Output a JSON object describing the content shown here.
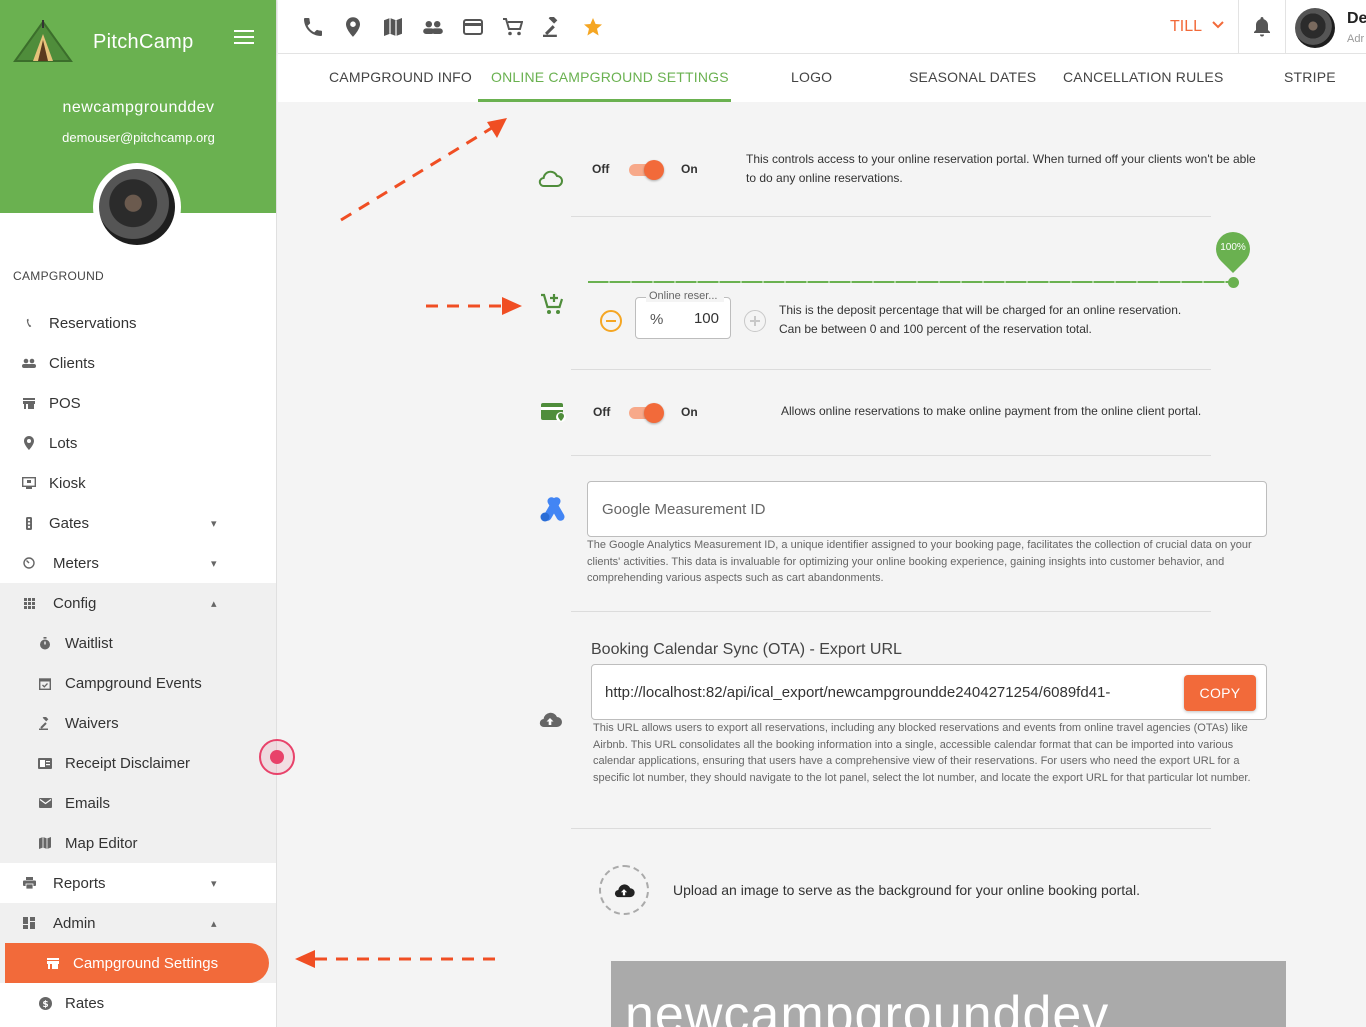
{
  "brand": {
    "name": "PitchCamp"
  },
  "user": {
    "name": "newcampgrounddev",
    "email": "demouser@pitchcamp.org"
  },
  "sidebar": {
    "section_label": "CAMPGROUND",
    "items": [
      {
        "label": "Reservations"
      },
      {
        "label": "Clients"
      },
      {
        "label": "POS"
      },
      {
        "label": "Lots"
      },
      {
        "label": "Kiosk"
      },
      {
        "label": "Gates"
      },
      {
        "label": "Meters"
      },
      {
        "label": "Config"
      },
      {
        "label": "Waitlist"
      },
      {
        "label": "Campground Events"
      },
      {
        "label": "Waivers"
      },
      {
        "label": "Receipt Disclaimer"
      },
      {
        "label": "Emails"
      },
      {
        "label": "Map Editor"
      },
      {
        "label": "Reports"
      },
      {
        "label": "Admin"
      },
      {
        "label": "Campground Settings"
      },
      {
        "label": "Rates"
      }
    ]
  },
  "topbar": {
    "till_label": "TILL",
    "user_short": "De",
    "role_short": "Adr"
  },
  "tabs": [
    {
      "label": "CAMPGROUND INFO"
    },
    {
      "label": "ONLINE CAMPGROUND SETTINGS"
    },
    {
      "label": "LOGO"
    },
    {
      "label": "SEASONAL DATES"
    },
    {
      "label": "CANCELLATION RULES"
    },
    {
      "label": "STRIPE"
    }
  ],
  "settings": {
    "portal": {
      "off_label": "Off",
      "on_label": "On",
      "description": "This controls access to your online reservation portal. When turned off your clients won't be able to do any online reservations."
    },
    "deposit": {
      "slider_value_label": "100%",
      "slider_value": 100,
      "field_label": "Online reser...",
      "field_prefix": "%",
      "field_value": "100",
      "description_line1": "This is the deposit percentage that will be charged for an online reservation.",
      "description_line2": "Can be between 0 and 100 percent of the reservation total."
    },
    "payment": {
      "off_label": "Off",
      "on_label": "On",
      "description": "Allows online reservations to make online payment from the online client portal."
    },
    "google": {
      "placeholder": "Google Measurement ID",
      "help": "The Google Analytics Measurement ID, a unique identifier assigned to your booking page, facilitates the collection of crucial data on your clients' activities. This data is invaluable for optimizing your online booking experience, gaining insights into customer behavior, and comprehending various aspects such as cart abandonments."
    },
    "ota": {
      "title": "Booking Calendar Sync (OTA) - Export URL",
      "url": "http://localhost:82/api/ical_export/newcampgroundde2404271254/6089fd41-",
      "copy_label": "COPY",
      "help": "This URL allows users to export all reservations, including any blocked reservations and events from online travel agencies (OTAs) like Airbnb. This URL consolidates all the booking information into a single, accessible calendar format that can be imported into various calendar applications, ensuring that users have a comprehensive view of their reservations. For users who need the export URL for a specific lot number, they should navigate to the lot panel, select the lot number, and locate the export URL for that particular lot number."
    },
    "upload": {
      "text": "Upload an image to serve as the background for your online booking portal."
    },
    "banner_text": "newcampgrounddev"
  },
  "colors": {
    "brand_green": "#6ab150",
    "accent_orange": "#f26a3a",
    "annotation_red": "#f04e23"
  }
}
